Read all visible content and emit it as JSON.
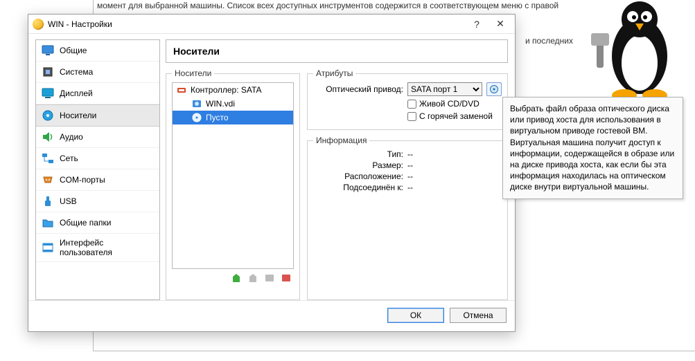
{
  "background": {
    "line1": "момент для выбранной машины. Список всех доступных инструментов содержится в соответствующем меню с правой стороны",
    "right_fragment": "и последних"
  },
  "dialog": {
    "title": "WIN - Настройки",
    "sidebar": [
      {
        "key": "general",
        "label": "Общие"
      },
      {
        "key": "system",
        "label": "Система"
      },
      {
        "key": "display",
        "label": "Дисплей"
      },
      {
        "key": "storage",
        "label": "Носители"
      },
      {
        "key": "audio",
        "label": "Аудио"
      },
      {
        "key": "network",
        "label": "Сеть"
      },
      {
        "key": "serial",
        "label": "COM-порты"
      },
      {
        "key": "usb",
        "label": "USB"
      },
      {
        "key": "shared",
        "label": "Общие папки"
      },
      {
        "key": "ui",
        "label": "Интерфейс пользователя"
      }
    ],
    "selected_sidebar": "storage",
    "panel_title": "Носители",
    "storage": {
      "group_label": "Носители",
      "controller_label": "Контроллер: SATA",
      "disk_label": "WIN.vdi",
      "empty_label": "Пусто"
    },
    "attributes": {
      "group_label": "Атрибуты",
      "drive_label": "Оптический привод:",
      "drive_options": [
        "SATA порт 1"
      ],
      "drive_selected": "SATA порт 1",
      "live_cd_label": "Живой CD/DVD",
      "hot_plug_label": "С горячей заменой"
    },
    "info": {
      "group_label": "Информация",
      "rows": [
        {
          "label": "Тип:",
          "value": "--"
        },
        {
          "label": "Размер:",
          "value": "--"
        },
        {
          "label": "Расположение:",
          "value": "--"
        },
        {
          "label": "Подсоединён к:",
          "value": "--"
        }
      ]
    },
    "buttons": {
      "ok": "ОК",
      "cancel": "Отмена"
    }
  },
  "tooltip": "Выбрать файл образа оптического диска или привод хоста для использования в виртуальном приводе гостевой ВМ. Виртуальная машина получит доступ к информации, содержащейся в образе или на диске привода хоста, как если бы эта информация находилась на оптическом диске внутри виртуальной машины."
}
